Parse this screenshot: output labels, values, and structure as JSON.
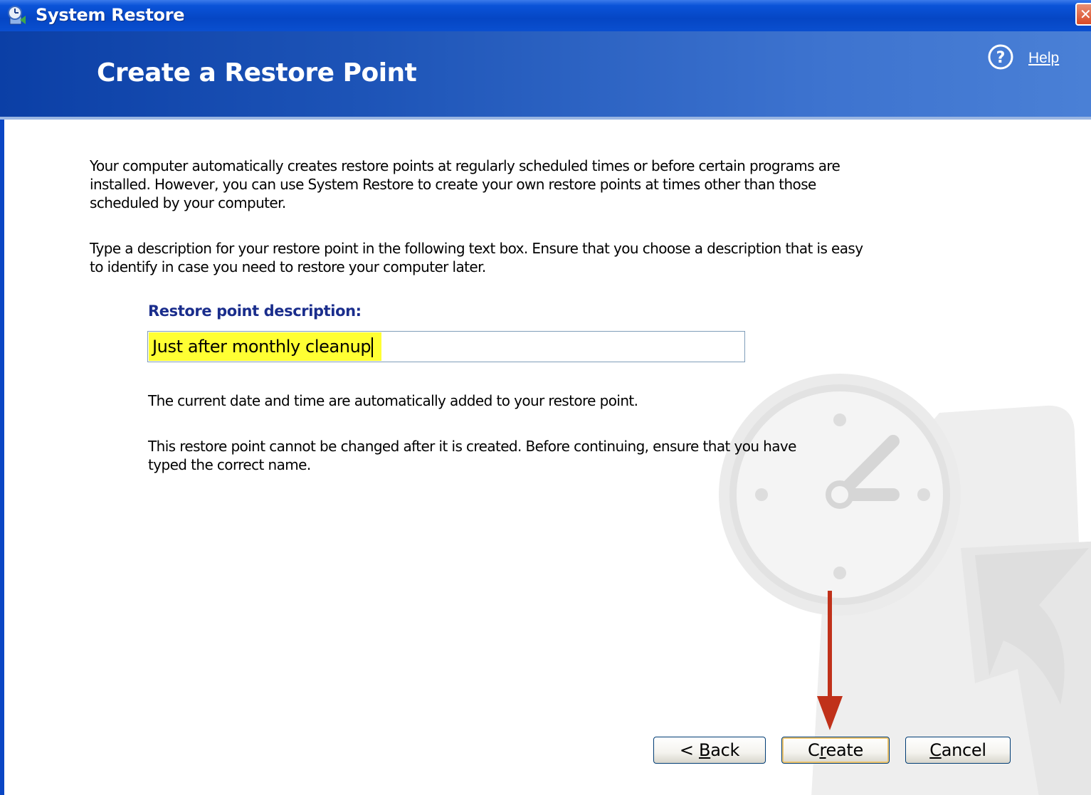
{
  "window": {
    "title": "System Restore",
    "title_icon": "system-restore-icon",
    "close_label": "✕"
  },
  "header": {
    "title": "Create a Restore Point",
    "help_label": "Help",
    "help_icon": "question-circle-icon"
  },
  "body": {
    "paragraph1": "Your computer automatically creates restore points at regularly scheduled times or before certain programs are installed. However, you can use System Restore to create your own restore points at times other than those scheduled by your computer.",
    "paragraph2": "Type a description for your restore point in the following text box. Ensure that you choose a description that is easy to identify in case you need to restore your computer later.",
    "field_label": "Restore point description:",
    "field_value": "Just after monthly cleanup",
    "paragraph3": "The current date and time are automatically added to your restore point.",
    "paragraph4": "This restore point cannot be changed after it is created. Before continuing, ensure that you have typed the correct name."
  },
  "buttons": {
    "back_prefix": "< ",
    "back_mnemonic": "B",
    "back_rest": "ack",
    "create_prefix": "C",
    "create_mnemonic": "r",
    "create_rest": "eate",
    "cancel_mnemonic": "C",
    "cancel_rest": "ancel"
  },
  "colors": {
    "title_bar": "#0546c4",
    "header_band": "#1e55b8",
    "field_label": "#1a2d8c",
    "input_highlight": "#ffff33",
    "annotation_arrow": "#c0311a"
  }
}
